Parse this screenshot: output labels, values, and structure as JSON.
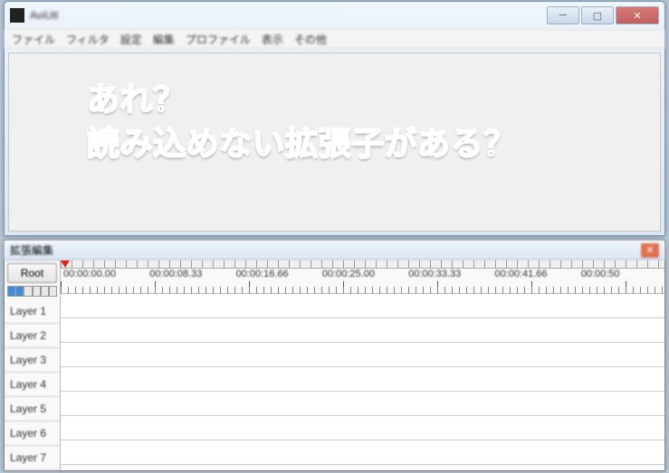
{
  "main": {
    "title": "AviUtl",
    "menu": [
      "ファイル",
      "フィルタ",
      "設定",
      "編集",
      "プロファイル",
      "表示",
      "その他"
    ]
  },
  "overlay": {
    "line1": "あれ？",
    "line2": "読み込めない拡張子がある？"
  },
  "timeline": {
    "title": "拡張編集",
    "root": "Root",
    "timecodes": [
      "00:00:00.00",
      "00:00:08.33",
      "00:00:16.66",
      "00:00:25.00",
      "00:00:33.33",
      "00:00:41.66",
      "00:00:50"
    ],
    "layers": [
      "Layer 1",
      "Layer 2",
      "Layer 3",
      "Layer 4",
      "Layer 5",
      "Layer 6",
      "Layer 7"
    ]
  }
}
